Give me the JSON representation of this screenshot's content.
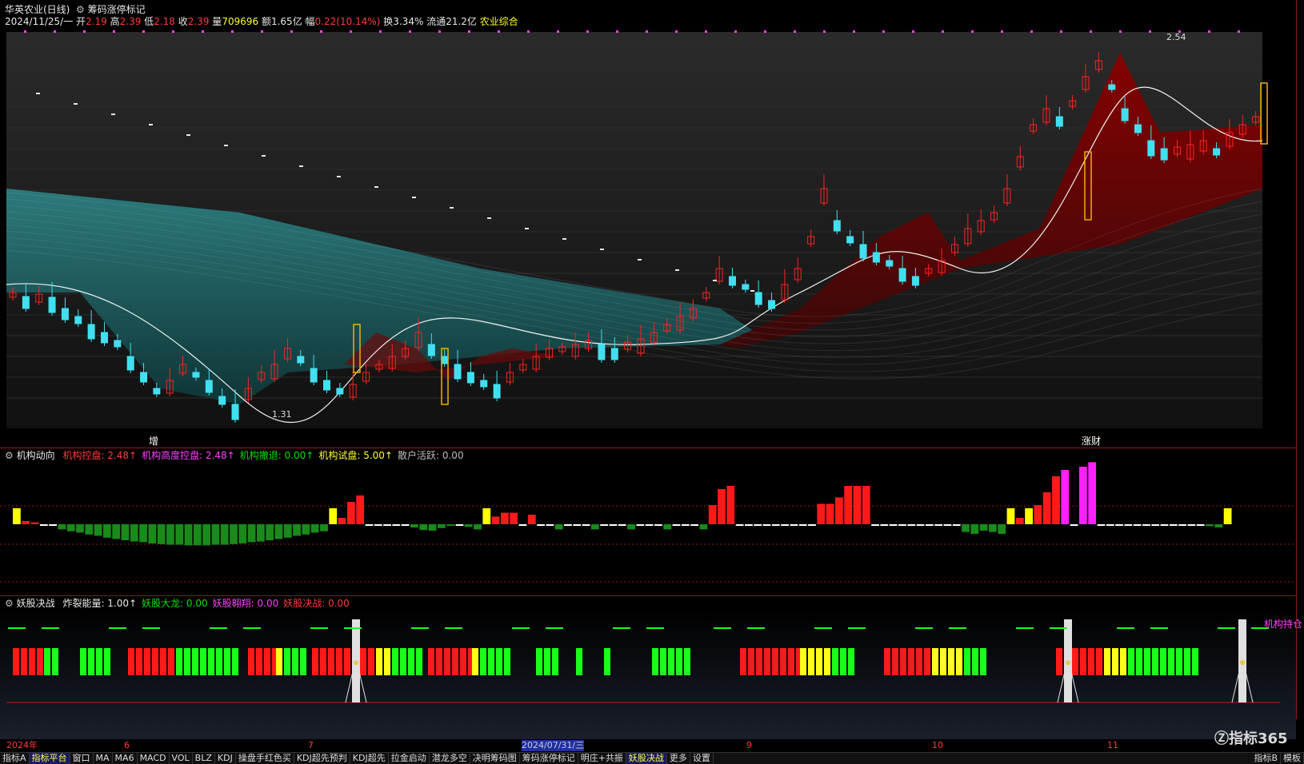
{
  "window": {
    "stock_title": "华英农业(日线)",
    "indicator_title": "筹码涨停标记"
  },
  "quote": {
    "date": "2024/11/25/一",
    "open_label": "开",
    "open": "2.19",
    "high_label": "高",
    "high": "2.39",
    "low_label": "低",
    "low": "2.18",
    "close_label": "收",
    "close": "2.39",
    "volume_label": "量",
    "volume": "709696",
    "amount_label": "额",
    "amount": "1.65亿",
    "change_label": "幅",
    "change": "0.22(10.14%)",
    "turnover_label": "换",
    "turnover": "3.34%",
    "float_label": "流通",
    "float": "21.2亿",
    "sector": "农业综合"
  },
  "main_chart": {
    "high_marker": "2.54",
    "low_marker": "1.31",
    "label_zeng": "增",
    "label_zhangcai": "涨财",
    "colors": {
      "up": "#ff2020",
      "down": "#40e0f0",
      "band_low": "#1f6f70",
      "band_high": "#7a0000"
    }
  },
  "panel1": {
    "title": "机构动向",
    "items": [
      {
        "label": "机构控盘: 2.48",
        "arrow": "↑",
        "color": "#ff3b3b"
      },
      {
        "label": "机构高度控盘: 2.48",
        "arrow": "↑",
        "color": "#ff40ff"
      },
      {
        "label": "机构撤退: 0.00",
        "arrow": "↑",
        "color": "#00e000"
      },
      {
        "label": "机构试盘: 5.00",
        "arrow": "↑",
        "color": "#ffff30"
      },
      {
        "label": "散户活跃: 0.00",
        "arrow": "",
        "color": "#bdbdbd"
      }
    ]
  },
  "panel2": {
    "title": "妖股决战",
    "items": [
      {
        "label": "炸裂能量: 1.00",
        "arrow": "↑",
        "color": "#e8e8e8"
      },
      {
        "label": "妖股大龙: 0.00",
        "arrow": "",
        "color": "#00e000"
      },
      {
        "label": "妖股翱翔: 0.00",
        "arrow": "",
        "color": "#ff40ff"
      },
      {
        "label": "妖股决战: 0.00",
        "arrow": "",
        "color": "#ff3b3b"
      }
    ],
    "right_label": "机构持仓"
  },
  "date_axis": {
    "labels": [
      "2024年",
      "6",
      "7",
      "2024/07/31/三",
      "9",
      "10",
      "11"
    ]
  },
  "watermark": "指标365",
  "tabs": [
    "指标A",
    "指标平台",
    "窗口",
    "MA",
    "MA6",
    "MACD",
    "VOL",
    "BLZ",
    "KDJ",
    "操盘手红色买",
    "KDJ超先预判",
    "KDJ超先",
    "拉金启动",
    "潜龙多空",
    "决明筹码图",
    "筹码涨停标记",
    "明庄+共振",
    "妖股决战",
    "更多",
    "设置"
  ],
  "tabs_right": [
    "指标B",
    "模板"
  ]
}
